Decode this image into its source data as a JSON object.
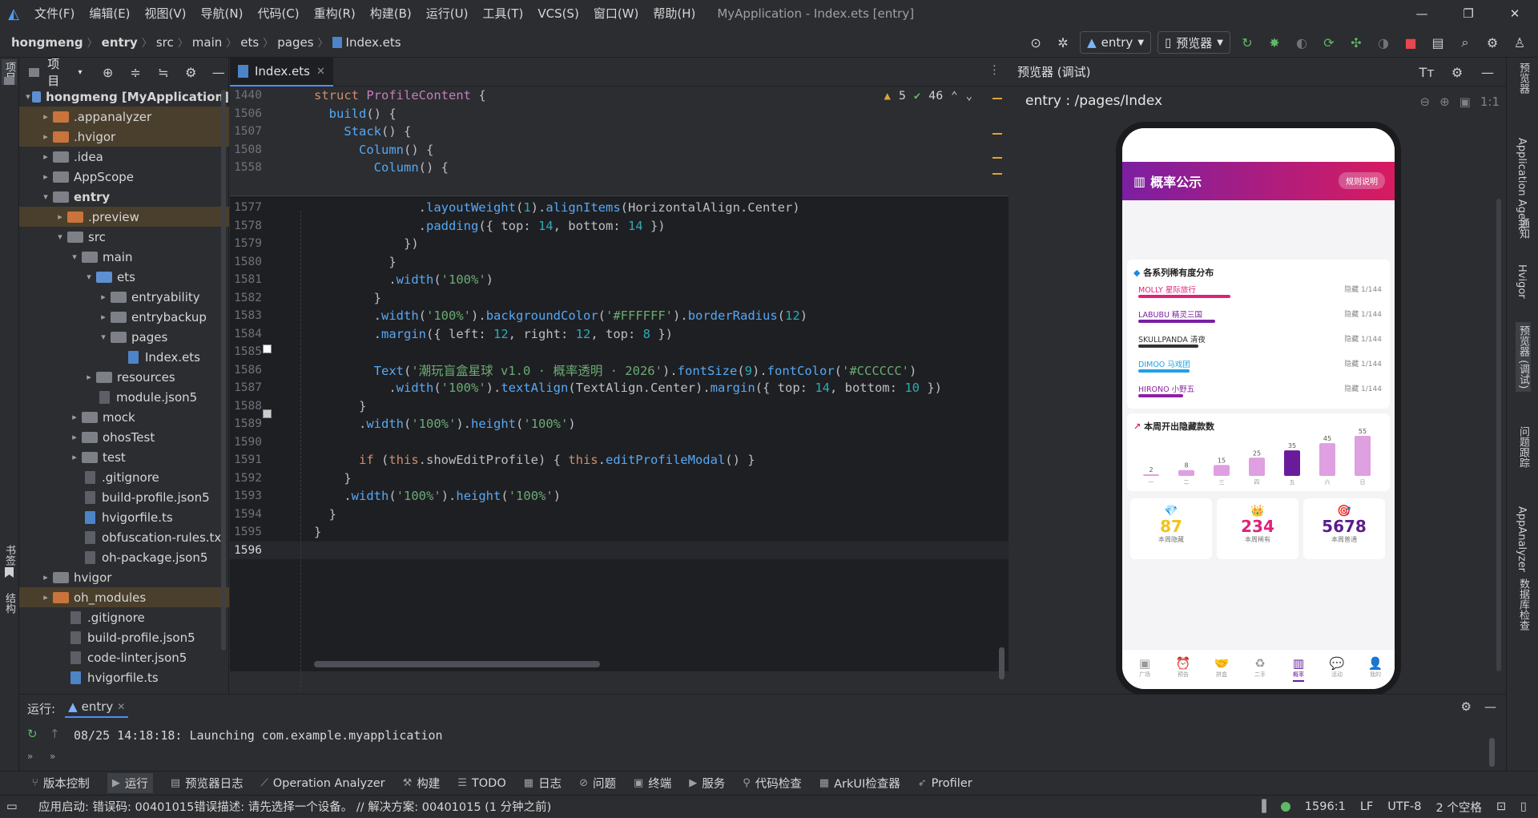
{
  "window": {
    "title": "MyApplication - Index.ets [entry]"
  },
  "menu": [
    "文件(F)",
    "编辑(E)",
    "视图(V)",
    "导航(N)",
    "代码(C)",
    "重构(R)",
    "构建(B)",
    "运行(U)",
    "工具(T)",
    "VCS(S)",
    "窗口(W)",
    "帮助(H)"
  ],
  "breadcrumb": [
    "hongmeng",
    "entry",
    "src",
    "main",
    "ets",
    "pages",
    "Index.ets"
  ],
  "toolbar": {
    "run_config": "entry",
    "device": "预览器"
  },
  "left_strip": {
    "project": "项目",
    "bookmarks": "书签",
    "structure": "结构"
  },
  "project_panel": {
    "title": "项目",
    "tree": [
      {
        "label": "hongmeng [MyApplication]",
        "depth": 0,
        "type": "bfolder",
        "open": true,
        "bold": true
      },
      {
        "label": ".appanalyzer",
        "depth": 1,
        "type": "ofolder",
        "open": false,
        "hl": true
      },
      {
        "label": ".hvigor",
        "depth": 1,
        "type": "ofolder",
        "open": false,
        "hl": true
      },
      {
        "label": ".idea",
        "depth": 1,
        "type": "folder",
        "open": false
      },
      {
        "label": "AppScope",
        "depth": 1,
        "type": "folder",
        "open": false
      },
      {
        "label": "entry",
        "depth": 1,
        "type": "folder",
        "open": true,
        "bold": true
      },
      {
        "label": ".preview",
        "depth": 2,
        "type": "ofolder",
        "open": false,
        "hl": true
      },
      {
        "label": "src",
        "depth": 2,
        "type": "folder",
        "open": true
      },
      {
        "label": "main",
        "depth": 3,
        "type": "folder",
        "open": true
      },
      {
        "label": "ets",
        "depth": 4,
        "type": "bfolder",
        "open": true
      },
      {
        "label": "entryability",
        "depth": 5,
        "type": "folder",
        "open": false
      },
      {
        "label": "entrybackup",
        "depth": 5,
        "type": "folder",
        "open": false
      },
      {
        "label": "pages",
        "depth": 5,
        "type": "folder",
        "open": true
      },
      {
        "label": "Index.ets",
        "depth": 6,
        "type": "efile"
      },
      {
        "label": "resources",
        "depth": 4,
        "type": "folder",
        "open": false
      },
      {
        "label": "module.json5",
        "depth": 4,
        "type": "file"
      },
      {
        "label": "mock",
        "depth": 3,
        "type": "folder",
        "open": false
      },
      {
        "label": "ohosTest",
        "depth": 3,
        "type": "folder",
        "open": false
      },
      {
        "label": "test",
        "depth": 3,
        "type": "folder",
        "open": false
      },
      {
        "label": ".gitignore",
        "depth": 3,
        "type": "file"
      },
      {
        "label": "build-profile.json5",
        "depth": 3,
        "type": "file"
      },
      {
        "label": "hvigorfile.ts",
        "depth": 3,
        "type": "efile"
      },
      {
        "label": "obfuscation-rules.txt",
        "depth": 3,
        "type": "file"
      },
      {
        "label": "oh-package.json5",
        "depth": 3,
        "type": "file"
      },
      {
        "label": "hvigor",
        "depth": 1,
        "type": "folder",
        "open": false
      },
      {
        "label": "oh_modules",
        "depth": 1,
        "type": "ofolder",
        "open": false,
        "hl": true
      },
      {
        "label": ".gitignore",
        "depth": 2,
        "type": "file"
      },
      {
        "label": "build-profile.json5",
        "depth": 2,
        "type": "file"
      },
      {
        "label": "code-linter.json5",
        "depth": 2,
        "type": "file"
      },
      {
        "label": "hvigorfile.ts",
        "depth": 2,
        "type": "efile"
      }
    ]
  },
  "editor": {
    "tab": "Index.ets",
    "inspection": {
      "warnings": "5",
      "weak_warnings": "46"
    },
    "sticky_lines": [
      {
        "ln": "1440",
        "html": "<span class=\"kw\">struct</span> <span class=\"cls\">ProfileContent</span> {"
      },
      {
        "ln": "1506",
        "html": "  <span class=\"fn\">build</span>() {"
      },
      {
        "ln": "1507",
        "html": "    <span class=\"fn\">Stack</span>() {"
      },
      {
        "ln": "1508",
        "html": "      <span class=\"fn\">Column</span>() {"
      },
      {
        "ln": "1558",
        "html": "        <span class=\"fn\">Column</span>() {"
      }
    ],
    "lines": [
      {
        "ln": "1577",
        "html": "              .<span class=\"fn\">layoutWeight</span>(<span class=\"nm\">1</span>).<span class=\"fn\">alignItems</span>(HorizontalAlign.Center)"
      },
      {
        "ln": "1578",
        "html": "              .<span class=\"fn\">padding</span>({ top: <span class=\"nm\">14</span>, bottom: <span class=\"nm\">14</span> })"
      },
      {
        "ln": "1579",
        "html": "            })"
      },
      {
        "ln": "1580",
        "html": "          }"
      },
      {
        "ln": "1581",
        "html": "          .<span class=\"fn\">width</span>(<span class=\"st\">'100%'</span>)"
      },
      {
        "ln": "1582",
        "html": "        }"
      },
      {
        "ln": "1583",
        "html": "        .<span class=\"fn\">width</span>(<span class=\"st\">'100%'</span>).<span class=\"fn\">backgroundColor</span>(<span class=\"st\">'#FFFFFF'</span>).<span class=\"fn\">borderRadius</span>(<span class=\"nm\">12</span>)"
      },
      {
        "ln": "1584",
        "html": "        .<span class=\"fn\">margin</span>({ left: <span class=\"nm\">12</span>, right: <span class=\"nm\">12</span>, top: <span class=\"nm\">8</span> })"
      },
      {
        "ln": "1585",
        "html": ""
      },
      {
        "ln": "1586",
        "html": "        <span class=\"fn\">Text</span>(<span class=\"st\">'潮玩盲盒星球 v1.0 · 概率透明 · 2026'</span>).<span class=\"fn\">fontSize</span>(<span class=\"nm\">9</span>).<span class=\"fn\">fontColor</span>(<span class=\"st\">'#CCCCCC'</span>)"
      },
      {
        "ln": "1587",
        "html": "          .<span class=\"fn\">width</span>(<span class=\"st\">'100%'</span>).<span class=\"fn\">textAlign</span>(TextAlign.Center).<span class=\"fn\">margin</span>({ top: <span class=\"nm\">14</span>, bottom: <span class=\"nm\">10</span> })"
      },
      {
        "ln": "1588",
        "html": "      }"
      },
      {
        "ln": "1589",
        "html": "      .<span class=\"fn\">width</span>(<span class=\"st\">'100%'</span>).<span class=\"fn\">height</span>(<span class=\"st\">'100%'</span>)"
      },
      {
        "ln": "1590",
        "html": ""
      },
      {
        "ln": "1591",
        "html": "      <span class=\"kw\">if</span> (<span class=\"th\">this</span>.showEditProfile) { <span class=\"th\">this</span>.<span class=\"fn\">editProfileModal</span>() }"
      },
      {
        "ln": "1592",
        "html": "    }"
      },
      {
        "ln": "1593",
        "html": "    .<span class=\"fn\">width</span>(<span class=\"st\">'100%'</span>).<span class=\"fn\">height</span>(<span class=\"st\">'100%'</span>)"
      },
      {
        "ln": "1594",
        "html": "  }"
      },
      {
        "ln": "1595",
        "html": "}"
      },
      {
        "ln": "1596",
        "html": ""
      }
    ]
  },
  "preview": {
    "title": "预览器 (调试)",
    "route": "entry : /pages/Index",
    "app": {
      "header_title": "概率公示",
      "header_btn": "规则说明",
      "series_title": "各系列稀有度分布",
      "series": [
        {
          "name": "MOLLY 星际旅行",
          "tag": "隐藏 1/144",
          "color": "#e0217a",
          "fill": 0.72
        },
        {
          "name": "LABUBU 精灵三国",
          "tag": "隐藏 1/144",
          "color": "#7a1fa2",
          "fill": 0.6
        },
        {
          "name": "SKULLPANDA 清夜",
          "tag": "隐藏 1/144",
          "color": "#333333",
          "fill": 0.47
        },
        {
          "name": "DIMOO 马戏团",
          "tag": "隐藏 1/144",
          "color": "#1ea0e6",
          "fill": 0.4
        },
        {
          "name": "HIRONO 小野五",
          "tag": "隐藏 1/144",
          "color": "#8e1fa6",
          "fill": 0.35
        }
      ],
      "weekly_title": "本周开出隐藏款数",
      "stats": [
        {
          "icon": "💎",
          "value": "87",
          "label": "本周隐藏",
          "color": "#f3c21c"
        },
        {
          "icon": "👑",
          "value": "234",
          "label": "本周稀有",
          "color": "#e0217a"
        },
        {
          "icon": "🎯",
          "value": "5678",
          "label": "本周普通",
          "color": "#5b1d8c"
        }
      ],
      "nav": [
        "广场",
        "预告",
        "拼盒",
        "二手",
        "概率",
        "活动",
        "我的"
      ]
    },
    "chart_data": {
      "type": "bar",
      "categories": [
        "一",
        "二",
        "三",
        "四",
        "五",
        "六",
        "日"
      ],
      "values": [
        2,
        8,
        15,
        25,
        35,
        45,
        55
      ],
      "highlight_index": 4,
      "ylim": [
        0,
        55
      ]
    }
  },
  "right_strip": [
    "预览器",
    "Application Agent",
    "通知",
    "Hvigor",
    "预览器 (调试)",
    "问题跟踪",
    "AppAnalyzer",
    "数据库检查"
  ],
  "run_panel": {
    "label": "运行:",
    "tab": "entry",
    "log": "08/25 14:18:18: Launching com.example.myapplication"
  },
  "bottom_tools": [
    "版本控制",
    "运行",
    "预览器日志",
    "Operation Analyzer",
    "构建",
    "TODO",
    "日志",
    "问题",
    "终端",
    "服务",
    "代码检查",
    "ArkUI检查器",
    "Profiler"
  ],
  "status": {
    "message": "应用启动: 错误码: 00401015错误描述: 请先选择一个设备。 // 解决方案: 00401015 (1 分钟之前)",
    "position": "1596:1",
    "line_sep": "LF",
    "encoding": "UTF-8",
    "indent": "2 个空格"
  }
}
